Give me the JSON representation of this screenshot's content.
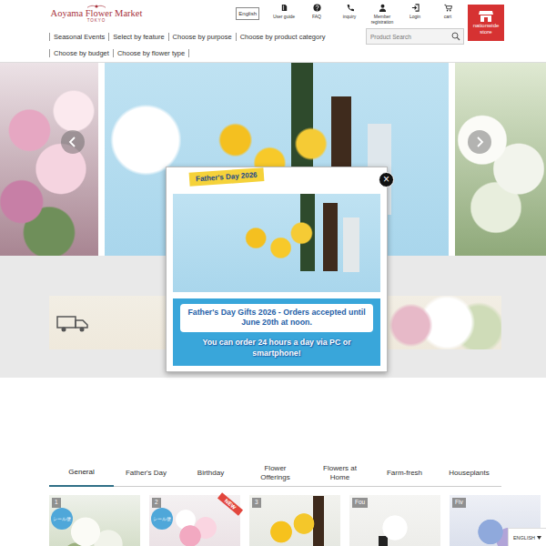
{
  "header": {
    "logo": "Aoyama Flower Market",
    "logo_sub": "TOKYO",
    "language": "English",
    "icons": [
      {
        "label": "User guide",
        "kind": "guide"
      },
      {
        "label": "FAQ",
        "kind": "faq"
      },
      {
        "label": "inquiry",
        "kind": "phone"
      },
      {
        "label": "Member registration",
        "kind": "member"
      },
      {
        "label": "Login",
        "kind": "login"
      },
      {
        "label": "cart",
        "kind": "cart"
      }
    ],
    "store_button": "nationwide store"
  },
  "nav": [
    "Seasonal Events",
    "Select by feature",
    "Choose by purpose",
    "Choose by product category"
  ],
  "nav2": [
    "Choose by budget",
    "Choose by flower type"
  ],
  "search": {
    "placeholder": "Product Search"
  },
  "popup": {
    "tag": "Father's Day 2026",
    "close": "×",
    "notice": "Father's Day Gifts 2026 - Orders accepted until June 20th at noon.",
    "subnote": "You can order 24 hours a day via PC or smartphone!"
  },
  "tabs": [
    {
      "label": "General",
      "selected": true
    },
    {
      "label": "Father's Day",
      "selected": false
    },
    {
      "label": "Birthday",
      "selected": false
    },
    {
      "label": "Flower Offerings",
      "selected": false
    },
    {
      "label": "Flowers at Home",
      "selected": false
    },
    {
      "label": "Farm-fresh",
      "selected": false
    },
    {
      "label": "Houseplants",
      "selected": false
    }
  ],
  "products": [
    {
      "rank": "1",
      "sticker": "シール便",
      "badge": ""
    },
    {
      "rank": "2",
      "sticker": "シール便",
      "badge": "NEW"
    },
    {
      "rank": "3",
      "sticker": "",
      "badge": ""
    },
    {
      "rank": "Fou",
      "sticker": "",
      "badge": ""
    },
    {
      "rank": "Fiv",
      "sticker": "",
      "badge": ""
    }
  ],
  "language_select": "ENGLISH"
}
